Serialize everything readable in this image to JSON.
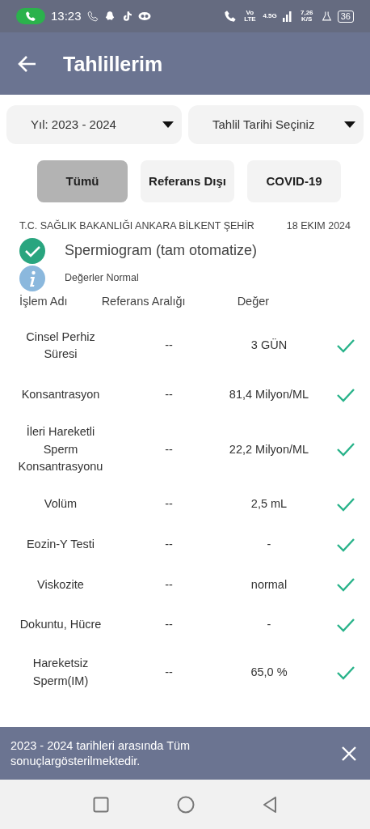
{
  "status_bar": {
    "time": "13:23",
    "network": "Vo LTE",
    "mobile": "4.5G",
    "speed": "7,26 K/S",
    "battery": "36"
  },
  "header": {
    "title": "Tahlillerim"
  },
  "dropdowns": [
    {
      "label": "Yıl: 2023 - 2024"
    },
    {
      "label": "Tahlil Tarihi Seçiniz"
    }
  ],
  "filters": [
    {
      "label": "Tümü",
      "selected": true
    },
    {
      "label": "Referans Dışı",
      "selected": false
    },
    {
      "label": "COVID-19",
      "selected": false
    }
  ],
  "result": {
    "institution": "T.C. SAĞLIK BAKANLIĞI ANKARA BİLKENT ŞEHİR",
    "date": "18 EKIM 2024",
    "test_name": "Spermiogram (tam otomatize)",
    "normal": true,
    "note": "Değerler Normal",
    "columns": [
      "İşlem Adı",
      "Referans Aralığı",
      "Değer"
    ],
    "rows": [
      {
        "name": "Cinsel Perhiz Süresi",
        "reference": "--",
        "value": "3 GÜN",
        "normal": true
      },
      {
        "name": "Konsantrasyon",
        "reference": "--",
        "value": "81,4 Milyon/ML",
        "normal": true
      },
      {
        "name": "İleri Hareketli Sperm Konsantrasyonu",
        "reference": "--",
        "value": "22,2 Milyon/ML",
        "normal": true
      },
      {
        "name": "Volüm",
        "reference": "--",
        "value": "2,5 mL",
        "normal": true
      },
      {
        "name": "Eozin-Y Testi",
        "reference": "--",
        "value": "-",
        "normal": true
      },
      {
        "name": "Viskozite",
        "reference": "--",
        "value": "normal",
        "normal": true
      },
      {
        "name": "Dokuntu, Hücre",
        "reference": "--",
        "value": "-",
        "normal": true
      },
      {
        "name": "Hareketsiz Sperm(IM)",
        "reference": "--",
        "value": "65,0 %",
        "normal": true
      }
    ]
  },
  "snackbar": {
    "message": "2023 - 2024 tarihleri arasında Tüm sonuçlargösterilmektedir."
  }
}
